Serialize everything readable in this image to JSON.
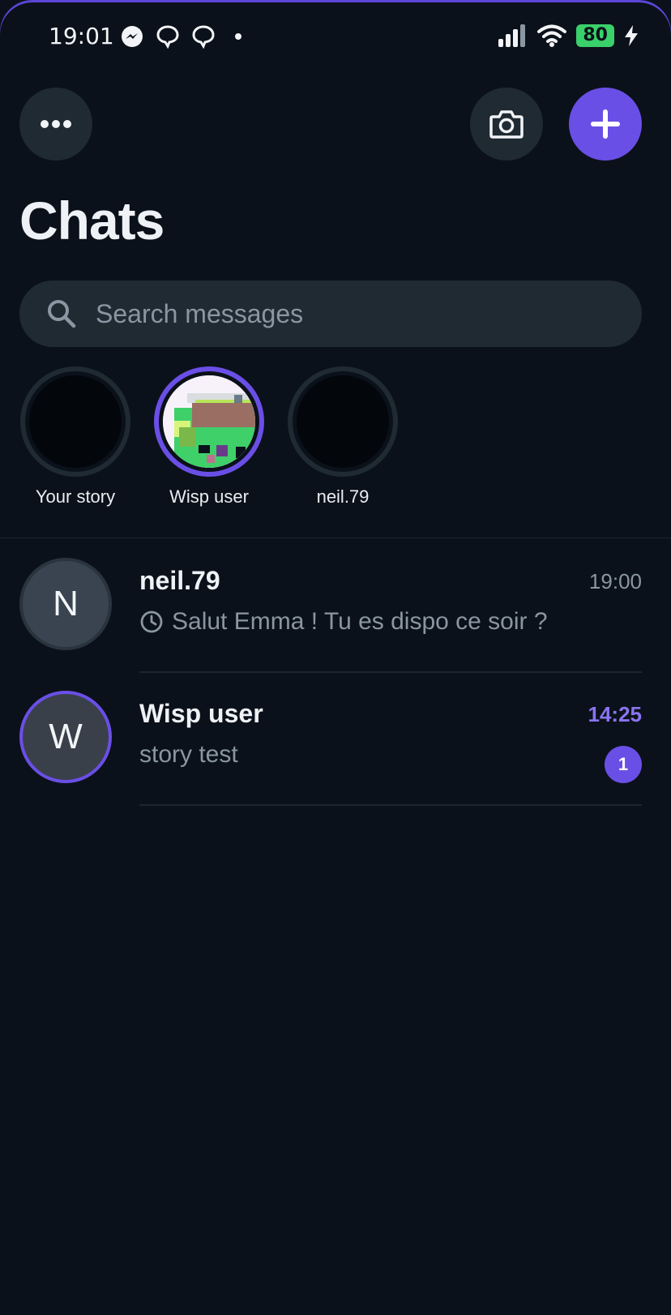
{
  "status_bar": {
    "time": "19:01",
    "battery": "80",
    "left_icons": [
      "messenger-icon",
      "chat-bubble-icon",
      "chat-bubble-icon"
    ],
    "right_icons": [
      "signal-icon",
      "wifi-icon",
      "battery-icon",
      "charging-icon"
    ]
  },
  "header": {
    "title": "Chats",
    "buttons": [
      "more-icon",
      "camera-icon",
      "plus-icon"
    ]
  },
  "search": {
    "placeholder": "Search messages"
  },
  "stories": [
    {
      "label": "Your story",
      "active": false
    },
    {
      "label": "Wisp user",
      "active": true
    },
    {
      "label": "neil.79",
      "active": false
    }
  ],
  "chats": [
    {
      "initial": "N",
      "name": "neil.79",
      "time": "19:00",
      "preview": "Salut Emma ! Tu es dispo ce soir ?",
      "status_icon": "clock-icon",
      "unread": false
    },
    {
      "initial": "W",
      "name": "Wisp user",
      "time": "14:25",
      "preview": "story test",
      "unread": true,
      "unread_count": "1"
    }
  ],
  "colors": {
    "background": "#0b111a",
    "surface": "#1f2a33",
    "accent": "#6a4fe6",
    "accent_text": "#8a74f0",
    "muted_text": "#8a96a1",
    "battery": "#3ad06a"
  }
}
